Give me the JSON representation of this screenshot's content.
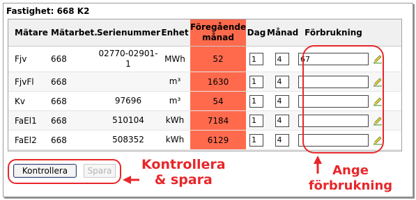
{
  "panel": {
    "title": "Fastighet: 668 K2"
  },
  "table": {
    "headers": {
      "meter": "Mätare",
      "meter_area": "Mätarbet.",
      "serial": "Serienummer",
      "unit": "Enhet",
      "prev_line1": "Föregående",
      "prev_line2": "månad",
      "day": "Dag",
      "month": "Månad",
      "consumption": "Förbrukning"
    },
    "rows": [
      {
        "meter": "Fjv",
        "area": "668",
        "serial_l1": "02770-02901-",
        "serial_l2": "1",
        "unit": "MWh",
        "prev": "52",
        "day": "1",
        "month": "4",
        "consumption": "67"
      },
      {
        "meter": "FjvFl",
        "area": "668",
        "serial_l1": "",
        "serial_l2": "",
        "unit": "m³",
        "prev": "1630",
        "day": "1",
        "month": "4",
        "consumption": ""
      },
      {
        "meter": "Kv",
        "area": "668",
        "serial_l1": "97696",
        "serial_l2": "",
        "unit": "m³",
        "prev": "54",
        "day": "1",
        "month": "4",
        "consumption": ""
      },
      {
        "meter": "FaEl1",
        "area": "668",
        "serial_l1": "510104",
        "serial_l2": "",
        "unit": "kWh",
        "prev": "7184",
        "day": "1",
        "month": "4",
        "consumption": ""
      },
      {
        "meter": "FaEl2",
        "area": "668",
        "serial_l1": "508352",
        "serial_l2": "",
        "unit": "kWh",
        "prev": "6129",
        "day": "1",
        "month": "4",
        "consumption": ""
      }
    ]
  },
  "buttons": {
    "check": "Kontrollera",
    "save": "Spara"
  },
  "annotations": {
    "check_save_line1": "Kontrollera",
    "check_save_line2": "& spara",
    "enter_line1": "Ange",
    "enter_line2": "förbrukning"
  },
  "colors": {
    "highlight": "#ff6a4d",
    "annotation": "#e8262a"
  },
  "icons": {
    "edit": "pencil-edit-icon"
  }
}
